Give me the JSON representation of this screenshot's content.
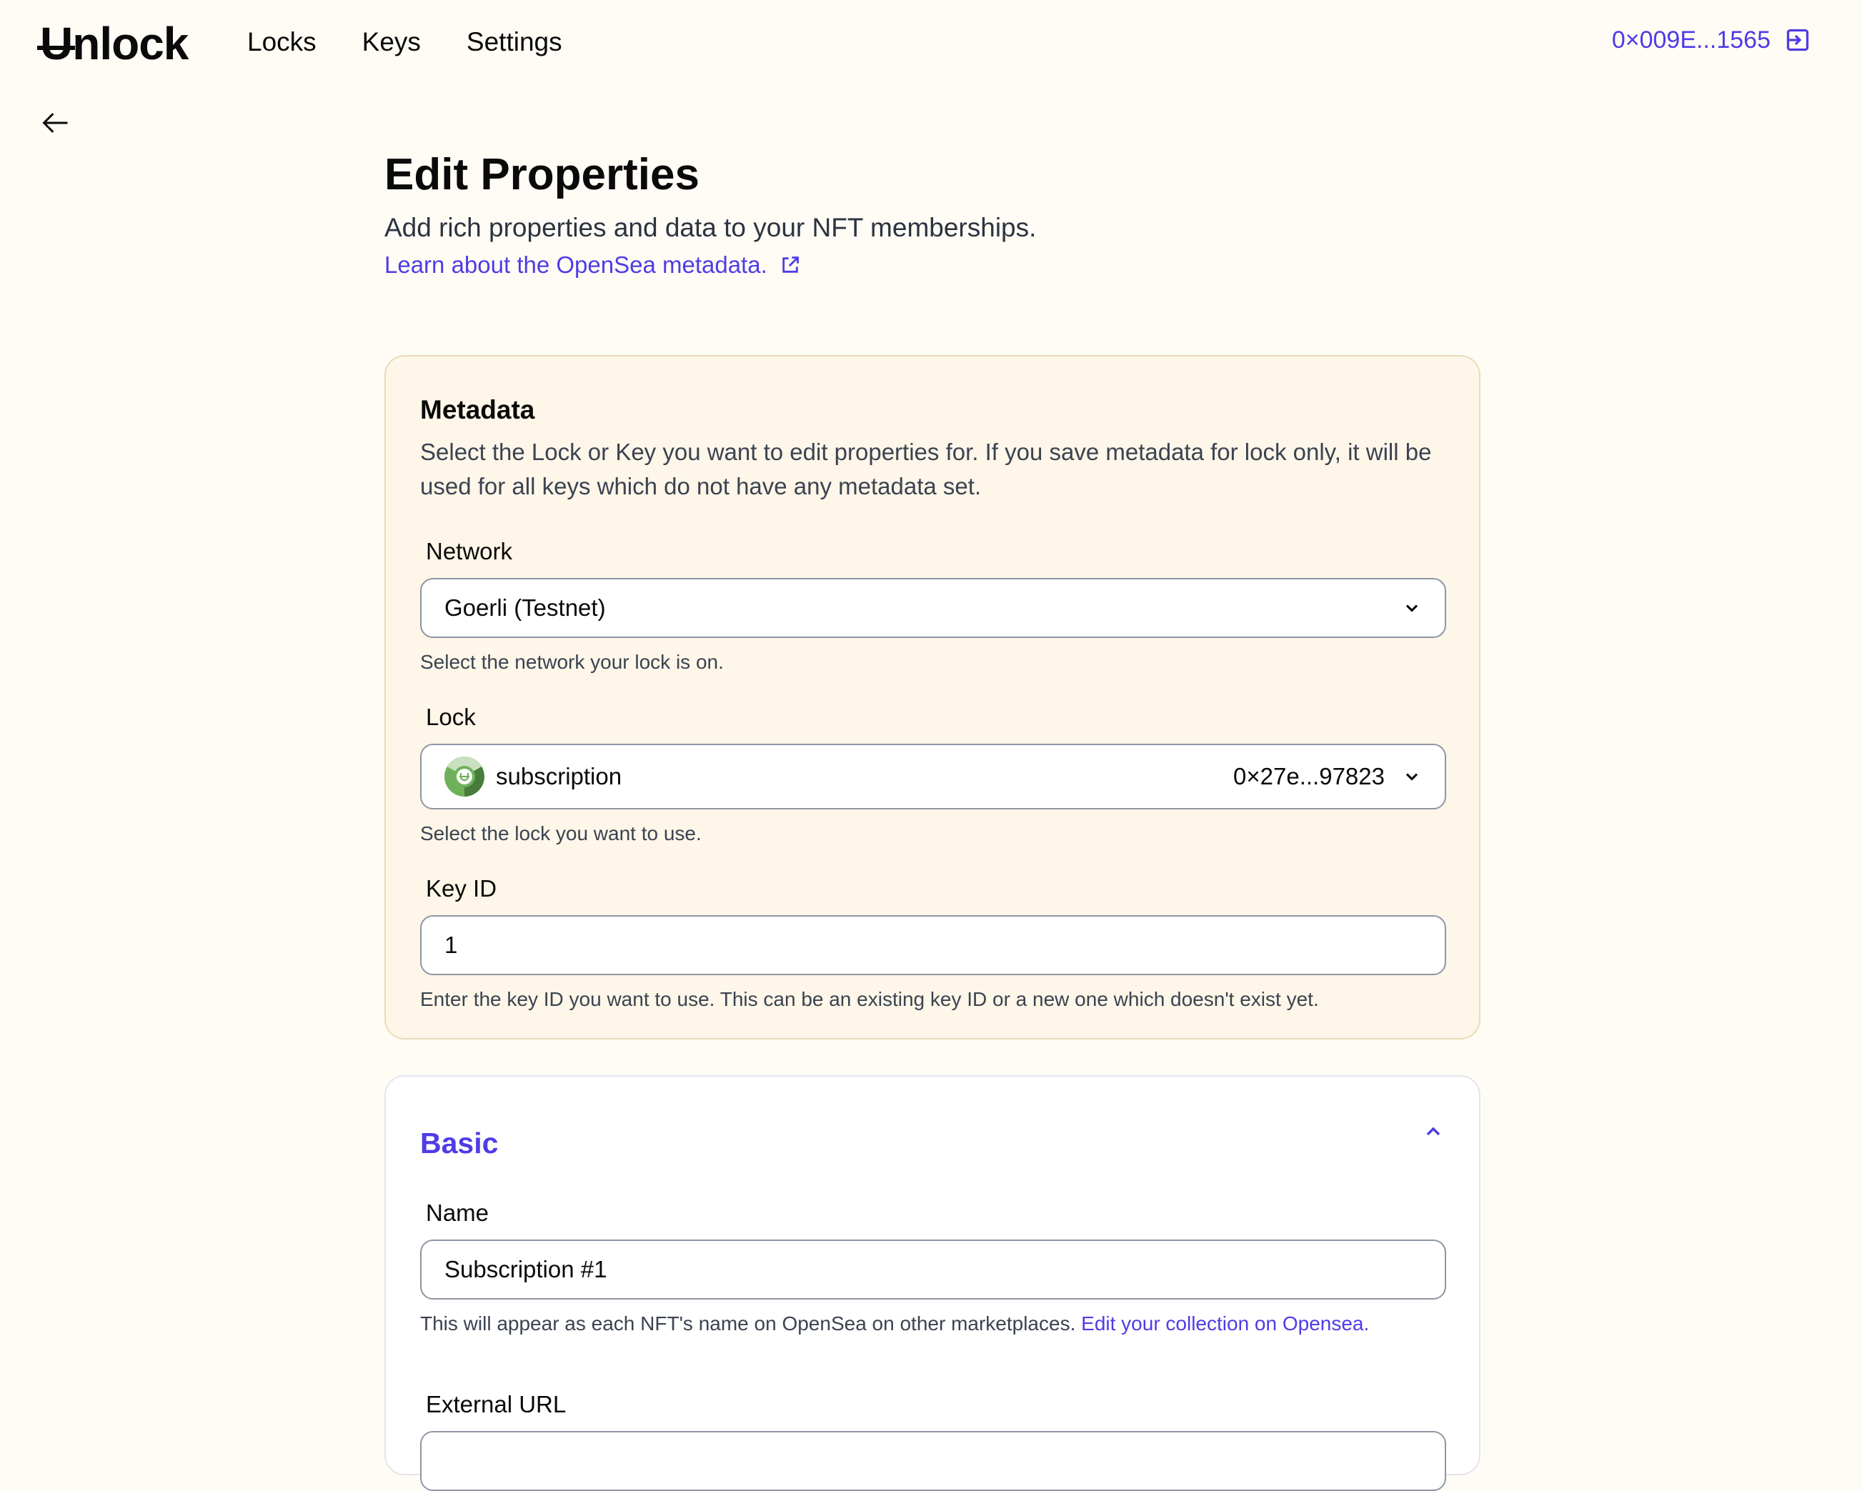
{
  "nav": {
    "logo": "Unlock",
    "links": [
      "Locks",
      "Keys",
      "Settings"
    ],
    "wallet_address": "0×009E...1565",
    "wallet_icon": "sign-in-icon"
  },
  "back": {
    "icon": "arrow-left-icon"
  },
  "header": {
    "title": "Edit Properties",
    "subtitle": "Add rich properties and data to your NFT memberships.",
    "learn_link": "Learn about the OpenSea metadata.",
    "learn_icon": "external-link-icon"
  },
  "metadata": {
    "title": "Metadata",
    "description": "Select the Lock or Key you want to edit properties for. If you save metadata for lock only, it will be used for all keys which do not have any metadata set.",
    "network": {
      "label": "Network",
      "value": "Goerli (Testnet)",
      "help": "Select the network your lock is on."
    },
    "lock": {
      "label": "Lock",
      "name": "subscription",
      "address": "0×27e...97823",
      "help": "Select the lock you want to use."
    },
    "key_id": {
      "label": "Key ID",
      "value": "1",
      "help": "Enter the key ID you want to use. This can be an existing key ID or a new one which doesn't exist yet."
    }
  },
  "basic": {
    "title": "Basic",
    "expanded": true,
    "name": {
      "label": "Name",
      "value": "Subscription #1",
      "help": "This will appear as each NFT's name on OpenSea on other marketplaces.",
      "help_link": "Edit your collection on Opensea."
    },
    "external_url": {
      "label": "External URL",
      "value": ""
    }
  },
  "colors": {
    "accent": "#4f3ce6",
    "background": "#fffcf5",
    "metadata_card": "#fdf6e9"
  }
}
